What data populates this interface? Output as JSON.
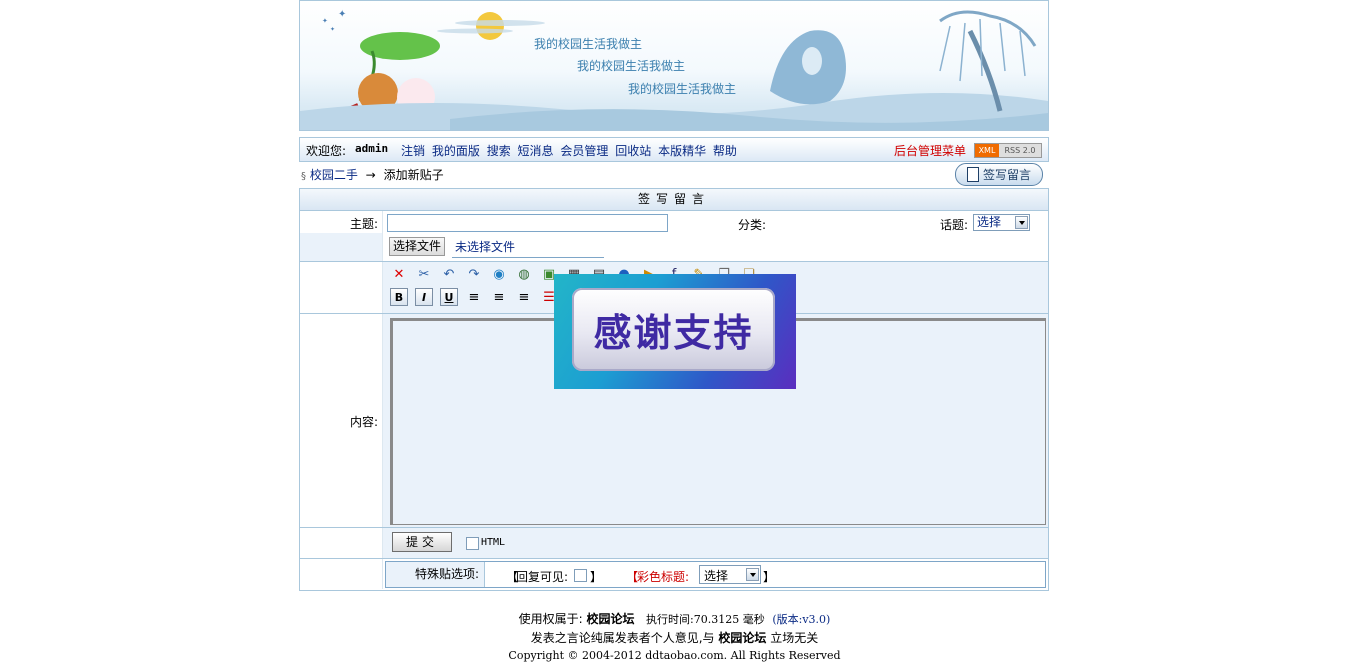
{
  "banner": {
    "motto1": "我的校园生活我做主",
    "motto2": "我的校园生活我做主",
    "motto3": "我的校园生活我做主"
  },
  "navbar": {
    "welcome": "欢迎您:",
    "username": "admin",
    "links": [
      "注销",
      "我的面版",
      "搜索",
      "短消息",
      "会员管理",
      "回收站",
      "本版精华",
      "帮助"
    ],
    "admin_menu": "后台管理菜单",
    "xml_badge": "XML",
    "rss_badge": "RSS 2.0"
  },
  "breadcrumb": {
    "marker": "§",
    "board": "校园二手",
    "arrow": "→",
    "current": "添加新贴子"
  },
  "post_button": "签写留言",
  "form": {
    "title": "签写留言",
    "subject_label": "主题:",
    "subject_value": "",
    "category_label": "分类:",
    "topic_label": "话题:",
    "topic_value": "选择",
    "file_button": "选择文件",
    "file_status": "未选择文件",
    "content_label": "内容:",
    "submit_label": "提交",
    "html_label": "HTML",
    "special_label": "特殊贴选项:",
    "reply_visible": "回复可见:",
    "color_title": "彩色标题:",
    "color_value": "选择",
    "bracket_open": "【",
    "bracket_close": "】"
  },
  "popup": {
    "text": "感谢支持"
  },
  "footer": {
    "owner_prefix": "使用权属于:",
    "owner": "校园论坛",
    "exec_prefix": "执行时间:70.3125 毫秒",
    "version": "(版本:v3.0)",
    "disclaimer_prefix": "发表之言论纯属发表者个人意见,与",
    "disclaimer_owner": "校园论坛",
    "disclaimer_suffix": "立场无关",
    "copyright": "Copyright © 2004-2012 ddtaobao.com. All Rights Reserved"
  },
  "colors": {
    "link": "#0a2a84",
    "admin": "#d00000",
    "border": "#a9c7dc",
    "cell": "#eaf2fa"
  }
}
